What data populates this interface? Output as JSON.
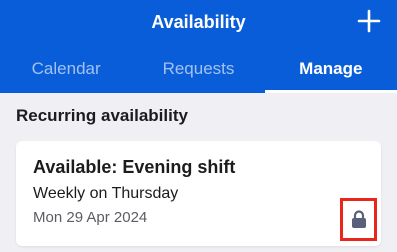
{
  "header": {
    "title": "Availability",
    "add_icon": "plus-icon"
  },
  "tabs": [
    {
      "label": "Calendar",
      "active": false
    },
    {
      "label": "Requests",
      "active": false
    },
    {
      "label": "Manage",
      "active": true
    }
  ],
  "section": {
    "title": "Recurring availability"
  },
  "card": {
    "title": "Available: Evening shift",
    "recurrence": "Weekly on Thursday",
    "date": "Mon 29 Apr 2024",
    "status_icon": "lock-icon"
  },
  "colors": {
    "brand": "#0a5dd8",
    "background": "#efeff4",
    "highlight": "#e8261b",
    "lock": "#5a607a"
  }
}
